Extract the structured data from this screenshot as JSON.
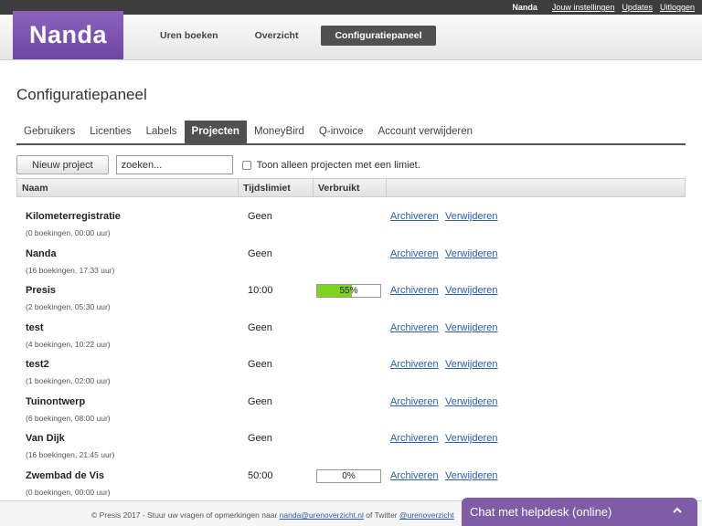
{
  "topbar": {
    "user": "Nanda",
    "links": [
      "Jouw instellingen",
      "Updates",
      "Uitloggen"
    ]
  },
  "logo": "Nanda",
  "nav": [
    "Uren boeken",
    "Overzicht",
    "Configuratiepaneel"
  ],
  "page_title": "Configuratiepaneel",
  "tabs": [
    "Gebruikers",
    "Licenties",
    "Labels",
    "Projecten",
    "MoneyBird",
    "Q-invoice",
    "Account verwijderen"
  ],
  "toolbar": {
    "new_project": "Nieuw project",
    "search_value": "zoeken...",
    "limit_filter": "Toon alleen projecten met een limiet."
  },
  "table": {
    "headers": [
      "Naam",
      "Tijdslimiet",
      "Verbruikt",
      ""
    ],
    "archive_label": "Archiveren",
    "delete_label": "Verwijderen",
    "rows": [
      {
        "name": "Kilometerregistratie",
        "meta": "(0 boekingen, 00:00 uur)",
        "limit": "Geen"
      },
      {
        "name": "Nanda",
        "meta": "(16 boekingen, 17:33 uur)",
        "limit": "Geen"
      },
      {
        "name": "Presis",
        "meta": "(2 boekingen, 05:30 uur)",
        "limit": "10:00",
        "used": "55%",
        "used_fraction": 0.55
      },
      {
        "name": "test",
        "meta": "(4 boekingen, 10:22 uur)",
        "limit": "Geen"
      },
      {
        "name": "test2",
        "meta": "(1 boekingen, 02:00 uur)",
        "limit": "Geen"
      },
      {
        "name": "Tuinontwerp",
        "meta": "(6 boekingen, 08:00 uur)",
        "limit": "Geen"
      },
      {
        "name": "Van Dijk",
        "meta": "(16 boekingen, 21:45 uur)",
        "limit": "Geen"
      },
      {
        "name": "Zwembad de Vis",
        "meta": "(0 boekingen, 00:00 uur)",
        "limit": "50:00",
        "used": "0%",
        "used_fraction": 0
      }
    ]
  },
  "footer": {
    "text_before": "© Presis 2017 - Stuur uw vragen of opmerkingen naar ",
    "email": "nanda@urenoverzicht.nl",
    "text_middle": " of Twitter ",
    "twitter": "@urenoverzicht"
  },
  "chat": {
    "label": "Chat met helpdesk (online)",
    "icon": "chevron-up-icon"
  },
  "colors": {
    "brand_purple": "#7f5ca8",
    "progress_green": "#7ed321",
    "link_blue": "#2a5db0"
  }
}
